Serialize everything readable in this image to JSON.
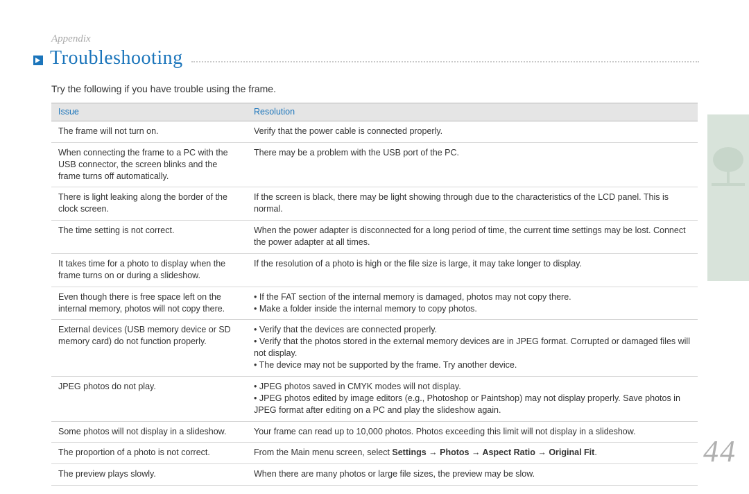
{
  "section": "Appendix",
  "title": "Troubleshooting",
  "intro": "Try the following if you have trouble using the frame.",
  "page_number": "44",
  "table": {
    "headers": {
      "issue": "Issue",
      "resolution": "Resolution"
    },
    "rows": [
      {
        "issue": "The frame will not turn on.",
        "resolution": "Verify that the power cable is connected properly."
      },
      {
        "issue": "When connecting the frame to a PC with the USB connector, the screen blinks and the frame turns off automatically.",
        "resolution": "There may be a problem with the USB port of the PC."
      },
      {
        "issue": "There is light leaking along the border of the clock screen.",
        "resolution": "If the screen is black, there may be light showing through due to the characteristics of the LCD panel. This is normal."
      },
      {
        "issue": "The time setting is not correct.",
        "resolution": "When the power adapter is disconnected for a long period of time, the current time settings may be lost. Connect the power adapter at all times."
      },
      {
        "issue": "It takes time for a photo to display when the frame turns on or during a slideshow.",
        "resolution": "If the resolution of a photo is high or the file size is large, it may take longer to display."
      },
      {
        "issue": "Even though there is free space left on the internal memory, photos will not copy there.",
        "resolution_list": [
          "If the FAT section of the internal memory is damaged, photos may not copy there.",
          "Make a folder inside the internal memory to copy photos."
        ]
      },
      {
        "issue": "External devices (USB memory device or SD memory card) do not function properly.",
        "resolution_list": [
          "Verify that the devices are connected properly.",
          "Verify that the photos stored in the external memory devices are in JPEG format. Corrupted or damaged files will not display.",
          "The device may not be supported by the frame. Try another device."
        ]
      },
      {
        "issue": "JPEG photos do not play.",
        "resolution_list": [
          "JPEG photos saved in CMYK modes will not display.",
          "JPEG photos edited by image editors (e.g., Photoshop or Paintshop) may not display properly. Save photos in JPEG format after editing on a PC and play the slideshow again."
        ]
      },
      {
        "issue": "Some photos will not display in a slideshow.",
        "resolution": "Your frame can read up to 10,000 photos. Photos exceeding this limit will not display in a slideshow."
      },
      {
        "issue": "The proportion of a photo is not correct.",
        "resolution_prefix": "From the Main menu screen, select ",
        "resolution_bold": "Settings → Photos → Aspect Ratio → Original Fit",
        "resolution_suffix": "."
      },
      {
        "issue": "The preview plays slowly.",
        "resolution": "When there are many photos or large file sizes, the preview may be slow."
      }
    ]
  }
}
